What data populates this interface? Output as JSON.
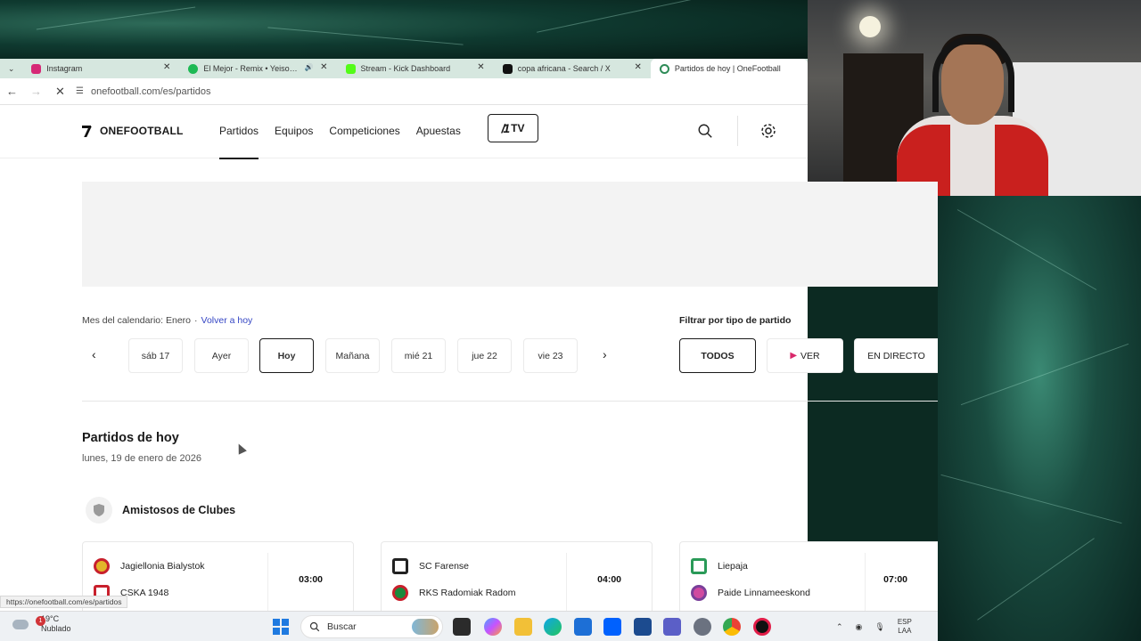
{
  "browser": {
    "tabs": [
      {
        "title": "Instagram",
        "color": "#d62976"
      },
      {
        "title": "El Mejor - Remix • Yeison Jiménez",
        "color": "#1db954",
        "audio": true
      },
      {
        "title": "Stream - Kick Dashboard",
        "color": "#53fc18"
      },
      {
        "title": "copa africana - Search / X",
        "color": "#111111"
      },
      {
        "title": "Partidos de hoy | OneFootball",
        "color": "#1a1a1a",
        "active": true
      }
    ],
    "url": "onefootball.com/es/partidos",
    "hover_url": "https://onefootball.com/es/partidos"
  },
  "site": {
    "brand": "ONEFOOTBALL",
    "nav": [
      "Partidos",
      "Equipos",
      "Competiciones",
      "Apuestas"
    ],
    "tv_label": "TV"
  },
  "calendar": {
    "month_label": "Mes del calendario:",
    "month": "Enero",
    "separator": "·",
    "back_today": "Volver a hoy",
    "days": [
      "sáb 17",
      "Ayer",
      "Hoy",
      "Mañana",
      "mié 21",
      "jue 22",
      "vie 23"
    ],
    "selected_day": "Hoy"
  },
  "filter": {
    "label": "Filtrar por tipo de partido",
    "options": [
      "TODOS",
      "VER",
      "EN DIRECTO"
    ],
    "selected": "TODOS"
  },
  "matches": {
    "title": "Partidos de hoy",
    "date": "lunes, 19 de enero de 2026",
    "competition": "Amistosos de Clubes",
    "cards": [
      {
        "home": "Jagiellonia Bialystok",
        "away": "CSKA 1948",
        "time": "03:00",
        "home_color": "#e2b52a",
        "away_color": "#c8202c"
      },
      {
        "home": "SC Farense",
        "away": "RKS Radomiak Radom",
        "time": "04:00",
        "home_color": "#222222",
        "away_color": "#1a8a3c"
      },
      {
        "home": "Liepaja",
        "away": "Paide Linnameeskond",
        "time": "07:00",
        "home_color": "#2a9a58",
        "away_color": "#7a3f9a"
      }
    ]
  },
  "taskbar": {
    "temperature": "19°C",
    "weather": "Nublado",
    "notification_count": "1",
    "search_placeholder": "Buscar",
    "lang_1": "ESP",
    "lang_2": "LAA"
  }
}
